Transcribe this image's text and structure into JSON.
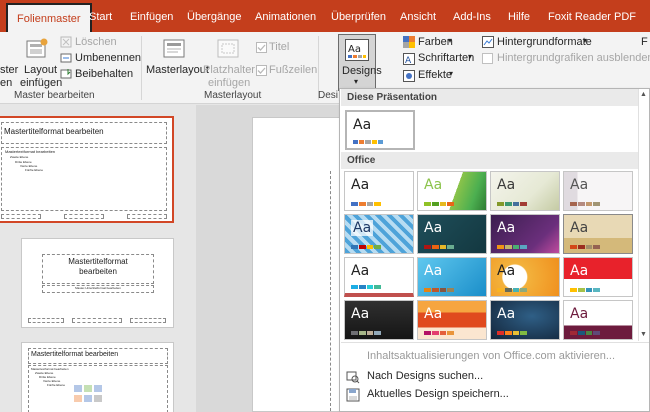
{
  "tabs": [
    "Folienmaster",
    "Start",
    "Einfügen",
    "Übergänge",
    "Animationen",
    "Überprüfen",
    "Ansicht",
    "Add-Ins",
    "Hilfe",
    "Foxit Reader PDF"
  ],
  "ribbon": {
    "insert_master_label_part": "ster",
    "insert_master_label_part2": "en",
    "layout_insert_1": "Layout",
    "layout_insert_2": "einfügen",
    "delete": "Löschen",
    "rename": "Umbenennen",
    "preserve": "Beibehalten",
    "group_master_edit": "Master bearbeiten",
    "master_layout": "Masterlayout",
    "placeholder_1": "Platzhalter",
    "placeholder_2": "einfügen",
    "title_check": "Titel",
    "footer_check": "Fußzeilen",
    "group_master_layout": "Masterlayout",
    "designs": "Designs",
    "group_design_part": "Desi",
    "colors": "Farben",
    "fonts": "Schriftarten",
    "effects": "Effekte",
    "bg_formats": "Hintergrundformate",
    "hide_bg": "Hintergrundgrafiken ausblenden",
    "right_cut": "F"
  },
  "slides": {
    "master_title": "Mastertitelformat bearbeiten",
    "master_text": "Mastertextformat bearbeiten",
    "level2": "Zweite Ebene",
    "level3": "Dritte Ebene",
    "level4": "Vierte Ebene",
    "level5": "Fünfte Ebene",
    "layout2_title_1": "Mastertitelformat",
    "layout2_title_2": "bearbeiten",
    "layout2_sub": "Master-Untertitelformat bearbeiten",
    "layout3_title": "Mastertitelformat bearbeiten"
  },
  "dropdown": {
    "section_this": "Diese Präsentation",
    "section_office": "Office",
    "aa": "Aa",
    "activate": "Inhaltsaktualisierungen von Office.com aktivieren...",
    "search": "Nach Designs suchen...",
    "save": "Aktuelles Design speichern..."
  },
  "colors": {
    "tab_bar": "#c43e1c",
    "ribbon_bg": "#f3f3f3",
    "selected_slide_border": "#d24726"
  }
}
